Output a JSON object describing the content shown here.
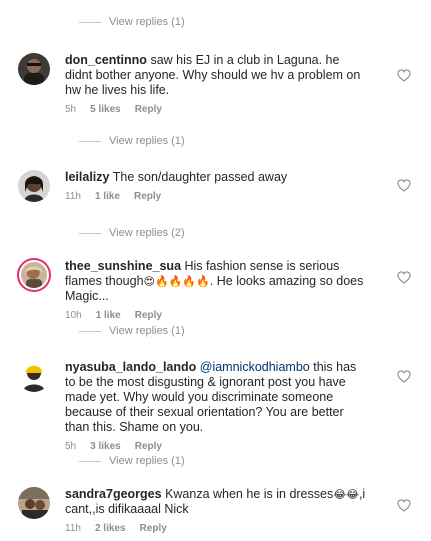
{
  "view_replies": [
    {
      "label": "View replies (1)"
    },
    {
      "label": "View replies (1)"
    },
    {
      "label": "View replies (2)"
    },
    {
      "label": "View replies (1)"
    },
    {
      "label": "View replies (1)"
    }
  ],
  "comments": [
    {
      "username": "don_centinno",
      "mention": "",
      "text": "saw his EJ in  a club in Laguna. he didnt bother anyone. Why should we hv a problem on hw he lives his life.",
      "time": "5h",
      "likes": "5 likes",
      "reply": "Reply"
    },
    {
      "username": "leilalizy",
      "mention": "",
      "text": "The son/daughter passed away",
      "time": "11h",
      "likes": "1 like",
      "reply": "Reply"
    },
    {
      "username": "thee_sunshine_sua",
      "mention": "",
      "text_before": "His fashion sense is serious flames though",
      "emojis": "😍🔥🔥🔥🔥",
      "text_after": ". He looks amazing so does Magic...",
      "time": "10h",
      "likes": "1 like",
      "reply": "Reply"
    },
    {
      "username": "nyasuba_lando_lando",
      "mention": "@iamnickodhiambo",
      "text": "this has to be the most disgusting & ignorant post you have made yet. Why would you discriminate someone because of their sexual orientation? You are better than this. Shame on you.",
      "time": "5h",
      "likes": "3 likes",
      "reply": "Reply"
    },
    {
      "username": "sandra7georges",
      "mention": "",
      "text_before": "Kwanza when he is in dresses",
      "emojis": "😂😂",
      "text_after": ",i cant,,is difikaaaal Nick",
      "time": "11h",
      "likes": "2 likes",
      "reply": "Reply"
    }
  ],
  "icons": {
    "like": "heart-outline-icon"
  },
  "colors": {
    "username": "#262626",
    "meta": "#8e8e8e",
    "mention": "#003569",
    "story_ring": "#e1306c"
  }
}
